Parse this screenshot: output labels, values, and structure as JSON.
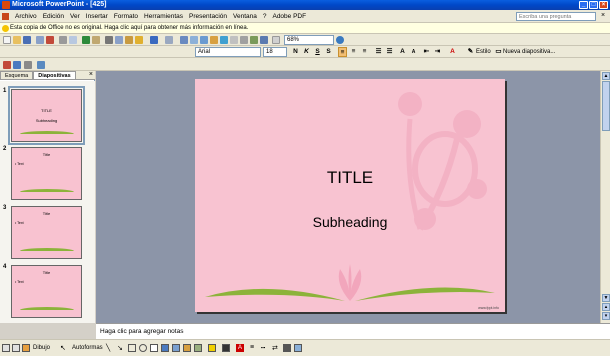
{
  "window": {
    "title": "Microsoft PowerPoint - [425]"
  },
  "menu": {
    "items": [
      "Archivo",
      "Edición",
      "Ver",
      "Insertar",
      "Formato",
      "Herramientas",
      "Presentación",
      "Ventana",
      "?",
      "Adobe PDF"
    ],
    "help_placeholder": "Escriba una pregunta"
  },
  "infobar": {
    "text": "Esta copia de Office no es original.  Haga clic aquí para obtener más información en línea."
  },
  "toolbar": {
    "zoom": "68%"
  },
  "format_toolbar": {
    "font": "Arial",
    "size": "18",
    "bold": "N",
    "italic": "K",
    "underline": "S",
    "shadow": "S",
    "design_label": "Estilo",
    "new_slide_label": "Nueva diapositiva..."
  },
  "left_pane": {
    "tabs": [
      "Esquema",
      "Diapositivas"
    ],
    "thumbnails": [
      {
        "number": "1",
        "title": "TITLE",
        "subtitle": "Subheading"
      },
      {
        "number": "2",
        "title": "Title",
        "bullet": "• Text"
      },
      {
        "number": "3",
        "title": "Title",
        "bullet": "• Text"
      },
      {
        "number": "4",
        "title": "Title",
        "bullet": "• Text"
      }
    ]
  },
  "slide": {
    "title": "TITLE",
    "subtitle": "Subheading",
    "url": "www.fppt.info",
    "colors": {
      "background": "#f8c3d1",
      "leaf": "#8cb33a",
      "flower": "#f2a6bc"
    }
  },
  "notes": {
    "placeholder": "Haga clic para agregar notas"
  },
  "draw_toolbar": {
    "draw_label": "Dibujo",
    "autoshapes_label": "Autoformas"
  }
}
